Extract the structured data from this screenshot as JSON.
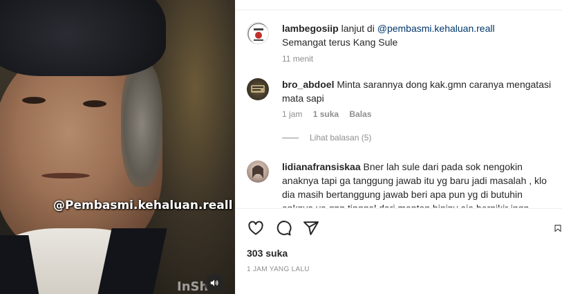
{
  "media": {
    "watermark": "@Pembasmi.kehaluan.reall",
    "editor_watermark": "InSh",
    "mute_icon": "speaker-icon"
  },
  "comments": [
    {
      "username": "lambegosiip",
      "prefix": "lanjut di ",
      "mention": "@pembasmi.kehaluan.reall",
      "line2": "Semangat terus Kang Sule",
      "time": "11 menit"
    },
    {
      "username": "bro_abdoel",
      "text": "Minta sarannya dong kak.gmn caranya mengatasi mata sapi",
      "time": "1 jam",
      "likes": "1 suka",
      "reply": "Balas",
      "view_replies": "Lihat balasan (5)"
    },
    {
      "username": "lidianafransiskaa",
      "text": "Bner lah sule dari pada sok nengokin anaknya tapi ga tanggung jawab itu yg baru jadi masalah , klo dia masih bertanggung jawab beri apa pun yg di butuhin anknya ya gpp tinggal dari mantan binipy aja berpikir ingn"
    }
  ],
  "actions": {
    "like_icon": "heart-icon",
    "comment_icon": "comment-icon",
    "share_icon": "paper-plane-icon",
    "save_icon": "bookmark-icon"
  },
  "likes": "303 suka",
  "posted": "1 JAM YANG LALU",
  "colors": {
    "text": "#262626",
    "muted": "#8e8e8e",
    "mention": "#00376b",
    "divider": "#efefef"
  }
}
